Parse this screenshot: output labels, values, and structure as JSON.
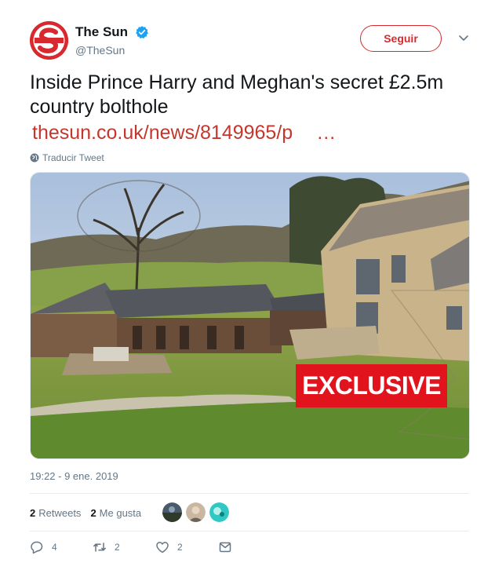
{
  "account": {
    "display_name": "The Sun",
    "handle": "@TheSun",
    "follow_label": "Seguir",
    "logo_letter": "S"
  },
  "tweet": {
    "text": "Inside Prince Harry and Meghan's secret £2.5m country bolthole",
    "link": "thesun.co.uk/news/8149965/p",
    "link_ellipsis": "…",
    "translate_label": "Traducir Tweet",
    "image_badge": "EXCLUSIVE",
    "timestamp": "19:22 - 9 ene. 2019"
  },
  "stats": {
    "retweets_count": "2",
    "retweets_label": "Retweets",
    "likes_count": "2",
    "likes_label": "Me gusta"
  },
  "actions": {
    "reply_count": "4",
    "retweet_count": "2",
    "like_count": "2"
  },
  "icons": {
    "verified": "verified-badge-icon",
    "caret": "chevron-down-icon",
    "globe": "globe-icon",
    "reply": "reply-icon",
    "retweet": "retweet-icon",
    "like": "heart-icon",
    "message": "direct-message-icon"
  },
  "colors": {
    "brand_red": "#d8292f",
    "link_red": "#c5362d",
    "verified_blue": "#1da1f2",
    "muted": "#657786",
    "badge_red": "#e1141e"
  }
}
